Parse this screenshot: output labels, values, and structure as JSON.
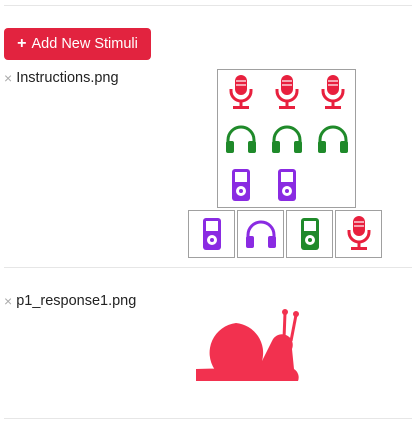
{
  "toolbar": {
    "add_label": "Add New Stimuli",
    "plus_glyph": "+"
  },
  "stimuli": [
    {
      "remove_glyph": "×",
      "filename": "Instructions.png"
    },
    {
      "remove_glyph": "×",
      "filename": "p1_response1.png"
    }
  ],
  "instructions_image": {
    "grid": [
      [
        "microphone-icon",
        "microphone-icon",
        "microphone-icon"
      ],
      [
        "headphones-icon",
        "headphones-icon",
        "headphones-icon"
      ],
      [
        "music-player-icon",
        "music-player-icon",
        ""
      ]
    ],
    "choices": [
      "music-player-icon",
      "headphones-icon",
      "music-player-icon",
      "microphone-icon"
    ],
    "colors": {
      "microphone": "#e8203e",
      "headphones": "#1f8a2a",
      "player": "#8a2be2",
      "player_green": "#1f8a2a",
      "headphones_purple": "#8a2be2"
    }
  },
  "response_image": {
    "icon": "snail-icon",
    "color": "#f2314f"
  }
}
